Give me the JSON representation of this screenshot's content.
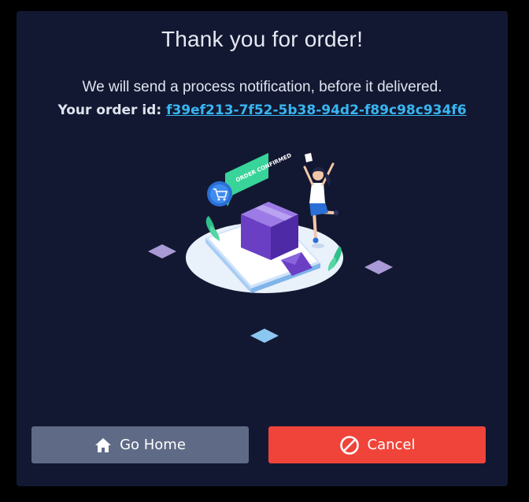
{
  "dialog": {
    "title": "Thank you for order!",
    "message": "We will send a process notification, before it delivered.",
    "order_label": "Your order id:",
    "order_id": "f39ef213-7f52-5b38-94d2-f89c98c934f6",
    "illustration": {
      "badge_text": "ORDER CONFIRMED"
    }
  },
  "buttons": {
    "home_label": "Go Home",
    "home_icon": "home-icon",
    "cancel_label": "Cancel",
    "cancel_icon": "ban-icon"
  },
  "colors": {
    "background": "#000000",
    "dialog": "#131832",
    "link": "#38b6f0",
    "home_button": "#5f6a86",
    "cancel_button": "#f0443a"
  }
}
